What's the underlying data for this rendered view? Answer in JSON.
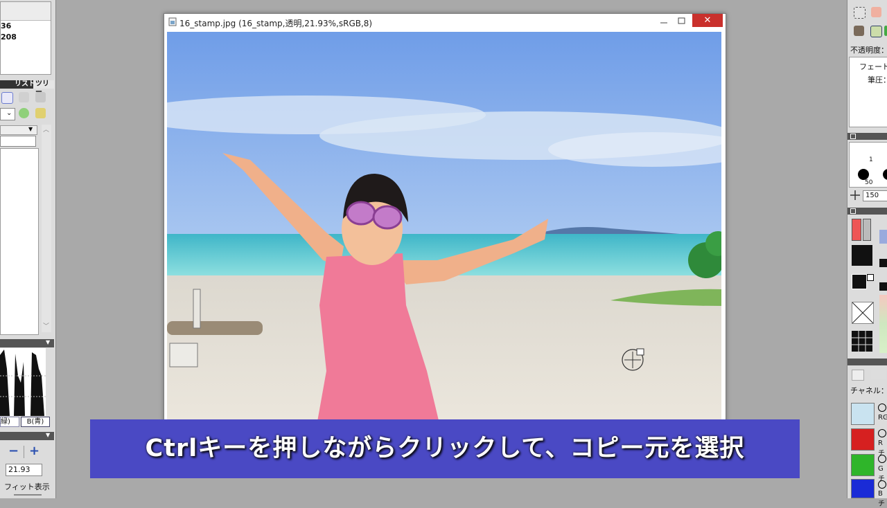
{
  "left_panel": {
    "info_lines": [
      "36",
      "208"
    ],
    "tabs": {
      "list": "リスト",
      "tree": "ツリー"
    },
    "histogram_labels": {
      "green": "緑)",
      "blue": "B(青)"
    },
    "zoom": {
      "minus": "−",
      "plus": "+",
      "value": "21.93",
      "fit_label": "フィット表示"
    }
  },
  "window": {
    "title": "16_stamp.jpg (16_stamp,透明,21.93%,sRGB,8)",
    "minimize_icon": "minimize-icon",
    "maximize_icon": "maximize-icon",
    "close_symbol": "✕"
  },
  "right_panel": {
    "opacity_label": "不透明度：",
    "fade_label": "フェード：",
    "pressure_label": "筆圧：",
    "brush_sizes": [
      "1",
      "50"
    ],
    "size_value": "150",
    "channel_label": "チャネル：表",
    "channels": [
      {
        "label": "RG",
        "color": "#c9e3f0"
      },
      {
        "label": "Rチ",
        "color": "#d62020"
      },
      {
        "label": "Gチ",
        "color": "#2fb52a"
      },
      {
        "label": "Bチ",
        "color": "#1a2bd6"
      }
    ]
  },
  "caption": {
    "text": "Ctrlキーを押しながらクリックして、コピー元を選択"
  },
  "colors": {
    "caption_bg": "#4a49c4",
    "close_button": "#c9302c",
    "workspace_bg": "#a9a9a9"
  }
}
